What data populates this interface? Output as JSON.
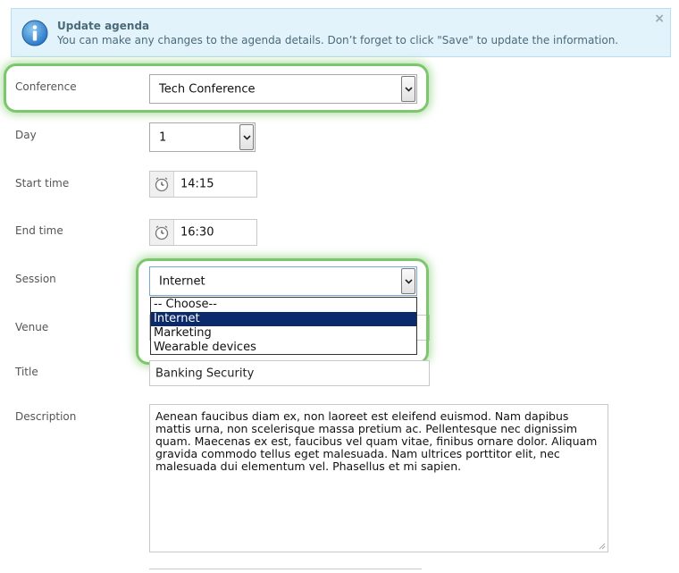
{
  "alert": {
    "title": "Update agenda",
    "message": "You can make any changes to the agenda details. Don’t forget to click \"Save\" to update the information.",
    "close": "×"
  },
  "fields": {
    "conference": {
      "label": "Conference",
      "value": "Tech Conference"
    },
    "day": {
      "label": "Day",
      "value": "1"
    },
    "start_time": {
      "label": "Start time",
      "value": "14:15"
    },
    "end_time": {
      "label": "End time",
      "value": "16:30"
    },
    "session": {
      "label": "Session",
      "value": "Internet",
      "options": [
        "-- Choose--",
        "Internet",
        "Marketing",
        "Wearable devices"
      ],
      "selected_index": 1
    },
    "venue": {
      "label": "Venue"
    },
    "title": {
      "label": "Title",
      "value": "Banking Security"
    },
    "description": {
      "label": "Description",
      "value": "Aenean faucibus diam ex, non laoreet est eleifend euismod. Nam dapibus mattis urna, non scelerisque massa pretium ac. Pellentesque nec dignissim quam. Maecenas ex est, faucibus vel quam vitae, finibus ornare dolor. Aliquam gravida commodo tellus eget malesuada. Nam ultrices porttitor elit, nec malesuada dui elementum vel. Phasellus et mi sapien."
    }
  },
  "colors": {
    "highlight": "#7cc66d",
    "selected_option": "#0b2a6b",
    "alert_bg": "#e3f3fb"
  },
  "icons": [
    "info-icon",
    "close-icon",
    "clock-icon",
    "chevron-down-icon",
    "resize-grip-icon"
  ]
}
